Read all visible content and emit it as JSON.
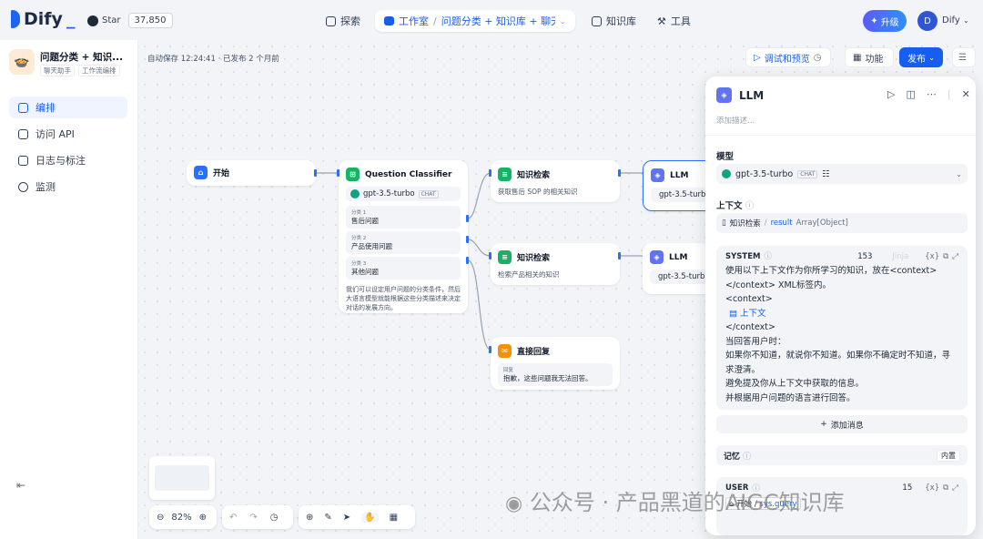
{
  "brand": {
    "logo": "Dify",
    "github": "Star",
    "stars": "37,850"
  },
  "nav": {
    "explore": "探索",
    "studio": "工作室",
    "app_crumb": "问题分类 + 知识库 + 聊天...",
    "knowledge": "知识库",
    "tools": "工具"
  },
  "account": {
    "upgrade": "升级",
    "initial": "D",
    "name": "Dify"
  },
  "sidebar": {
    "app_name": "问题分类 + 知识...",
    "tags": [
      "聊天助手",
      "工作流编排"
    ],
    "items": [
      {
        "label": "编排"
      },
      {
        "label": "访问 API"
      },
      {
        "label": "日志与标注"
      },
      {
        "label": "监测"
      }
    ]
  },
  "toolbar": {
    "autosave": "自动保存 12:24:41 · 已发布 2 个月前",
    "debug": "调试和预览",
    "features": "功能",
    "publish": "发布"
  },
  "nodes": {
    "start": {
      "title": "开始"
    },
    "classifier": {
      "title": "Question Classifier",
      "model": "gpt-3.5-turbo",
      "mode": "CHAT",
      "classes": [
        {
          "tag": "分类 1",
          "label": "售后问题"
        },
        {
          "tag": "分类 2",
          "label": "产品使用问题"
        },
        {
          "tag": "分类 3",
          "label": "其他问题"
        }
      ],
      "desc": "我们可以设定用户问题的分类条件，然后大语言模型就能根据这些分类描述来决定对话的发展方向。"
    },
    "kr1": {
      "title": "知识检索",
      "desc": "获取售后 SOP 的相关知识"
    },
    "kr2": {
      "title": "知识检索",
      "desc": "检索产品相关的知识"
    },
    "answer": {
      "title": "直接回复",
      "label": "回复",
      "text": "抱歉，这些问题我无法回答。"
    },
    "llm1": {
      "title": "LLM",
      "model": "gpt-3.5-turb"
    },
    "llm2": {
      "title": "LLM",
      "model": "gpt-3.5-turb"
    }
  },
  "panel": {
    "title": "LLM",
    "desc_placeholder": "添加描述...",
    "model_label": "模型",
    "model": "gpt-3.5-turbo",
    "mode": "CHAT",
    "context_label": "上下文",
    "ctx_node": "知识检索",
    "ctx_var": "result",
    "ctx_type": "Array[Object]",
    "system": "SYSTEM",
    "tokens": "153",
    "jinja": "Jinja",
    "prompt": [
      "使用以下上下文作为你所学习的知识，放在<context></context> XML标签内。",
      "<context>",
      "上下文",
      "</context>",
      "当回答用户时：",
      "如果你不知道，就说你不知道。如果你不确定时不知道，寻求澄清。",
      "避免提及你从上下文中获取的信息。",
      "并根据用户问题的语言进行回答。"
    ],
    "add_msg": "添加消息",
    "memory_label": "记忆",
    "memory_value": "内置",
    "user": "USER",
    "user_tokens": "15",
    "user_node": "开始",
    "user_var": "sys.query"
  },
  "zoom": {
    "level": "82%"
  },
  "watermark": "公众号 · 产品黑道的AIGC知识库",
  "colors": {
    "accent": "#155eef",
    "start": "#2970ff",
    "classifier": "#16b364",
    "knowledge": "#16b364",
    "answer": "#f79009",
    "llm": "#6172f3"
  }
}
